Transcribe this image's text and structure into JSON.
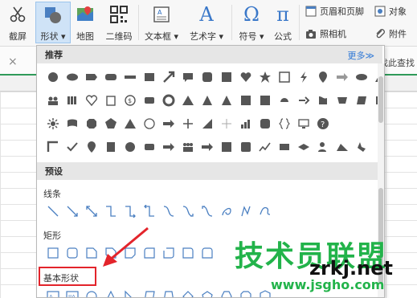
{
  "ribbon": {
    "screenshot": "截屏",
    "shapes": "形状",
    "map": "地图",
    "qrcode": "二维码",
    "textbox": "文本框",
    "wordart": "艺术字",
    "symbol": "符号",
    "formula": "公式",
    "header_footer": "页眉和页脚",
    "object": "对象",
    "camera": "照相机",
    "attachment": "附件"
  },
  "formula_bar": {
    "close_glyph": "×",
    "hint": "找此查找"
  },
  "panel": {
    "recommend_header": "推荐",
    "more_link": "更多≫",
    "preset_header": "预设",
    "categories": {
      "lines": "线条",
      "rectangles": "矩形",
      "basic_shapes": "基本形状"
    }
  },
  "icons": {
    "ribbon": [
      "scissors-icon",
      "shapes-icon",
      "map-pin-icon",
      "qr-code-icon",
      "textbox-icon",
      "wordart-icon",
      "omega-icon",
      "pi-icon",
      "header-footer-icon",
      "object-icon",
      "camera-icon",
      "paperclip-icon"
    ]
  },
  "colors": {
    "accent_blue": "#2f78d6",
    "active_bg": "#cfe3f7",
    "highlight_red": "#e3242b",
    "sheet_green": "#2f9a59",
    "watermark_green": "#22b34a"
  },
  "watermark": {
    "logo_text": "技术员联盟",
    "url": "www.jsgho.com",
    "domain": "zrkj.net"
  }
}
